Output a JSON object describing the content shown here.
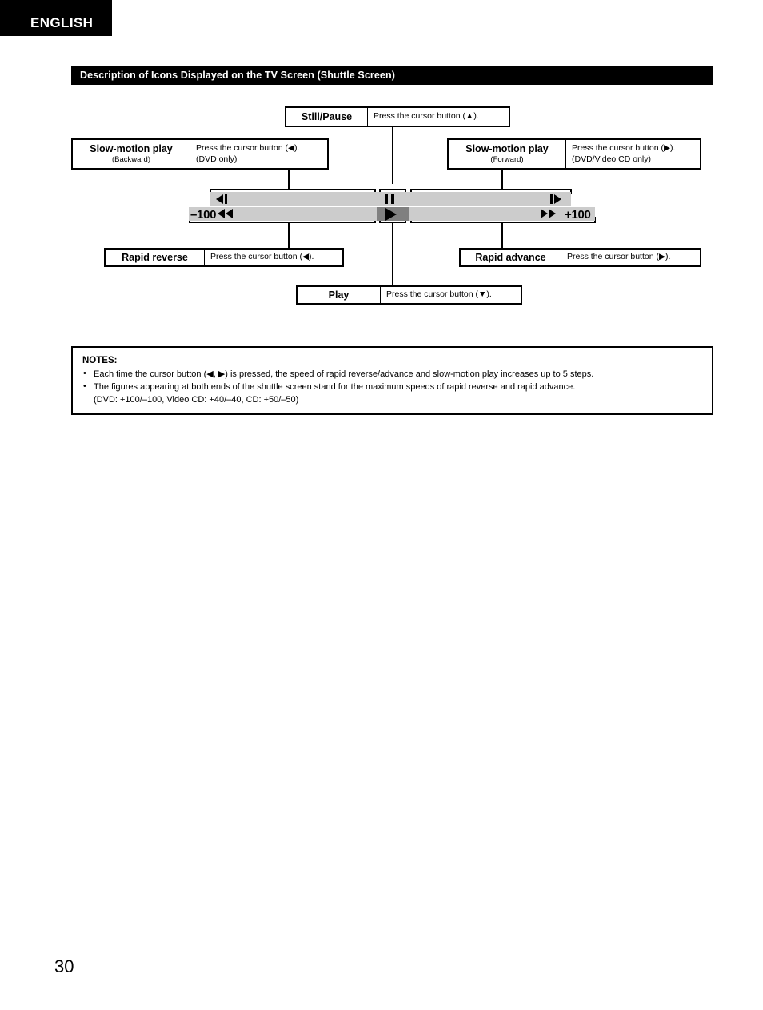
{
  "language_tab": "ENGLISH",
  "section_header": "Description of Icons Displayed on the TV Screen (Shuttle Screen)",
  "page_number": "30",
  "diagram": {
    "still_pause": {
      "title": "Still/Pause",
      "subtitle": "",
      "desc_line1": "Press the cursor button (▲).",
      "desc_line2": ""
    },
    "slow_backward": {
      "title": "Slow-motion play",
      "subtitle": "(Backward)",
      "desc_line1": "Press the cursor button (◀).",
      "desc_line2": "(DVD only)"
    },
    "slow_forward": {
      "title": "Slow-motion play",
      "subtitle": "(Forward)",
      "desc_line1": "Press the cursor button (▶).",
      "desc_line2": "(DVD/Video CD only)"
    },
    "rapid_reverse": {
      "title": "Rapid reverse",
      "subtitle": "",
      "desc_line1": "Press the cursor button (◀).",
      "desc_line2": ""
    },
    "rapid_advance": {
      "title": "Rapid advance",
      "subtitle": "",
      "desc_line1": "Press the cursor button (▶).",
      "desc_line2": ""
    },
    "play": {
      "title": "Play",
      "subtitle": "",
      "desc_line1": "Press the cursor button (▼).",
      "desc_line2": ""
    },
    "shuttle": {
      "min_label": "–100",
      "max_label": "+100",
      "track_color": "#cccccc",
      "active_segment_color": "#808080",
      "icons": {
        "slow_backward": "slow-reverse-icon",
        "still_pause": "pause-icon",
        "slow_forward": "slow-forward-icon",
        "rapid_reverse": "rewind-icon",
        "play": "play-icon",
        "rapid_advance": "fast-forward-icon"
      }
    }
  },
  "notes": {
    "header": "NOTES:",
    "items": [
      "Each time the cursor button (◀, ▶) is pressed, the speed of rapid reverse/advance and slow-motion play increases up to 5 steps.",
      "The figures appearing at both ends of the shuttle screen stand for the maximum speeds of rapid reverse and rapid advance."
    ],
    "continuation": "(DVD: +100/–100, Video CD: +40/–40, CD: +50/–50)"
  }
}
